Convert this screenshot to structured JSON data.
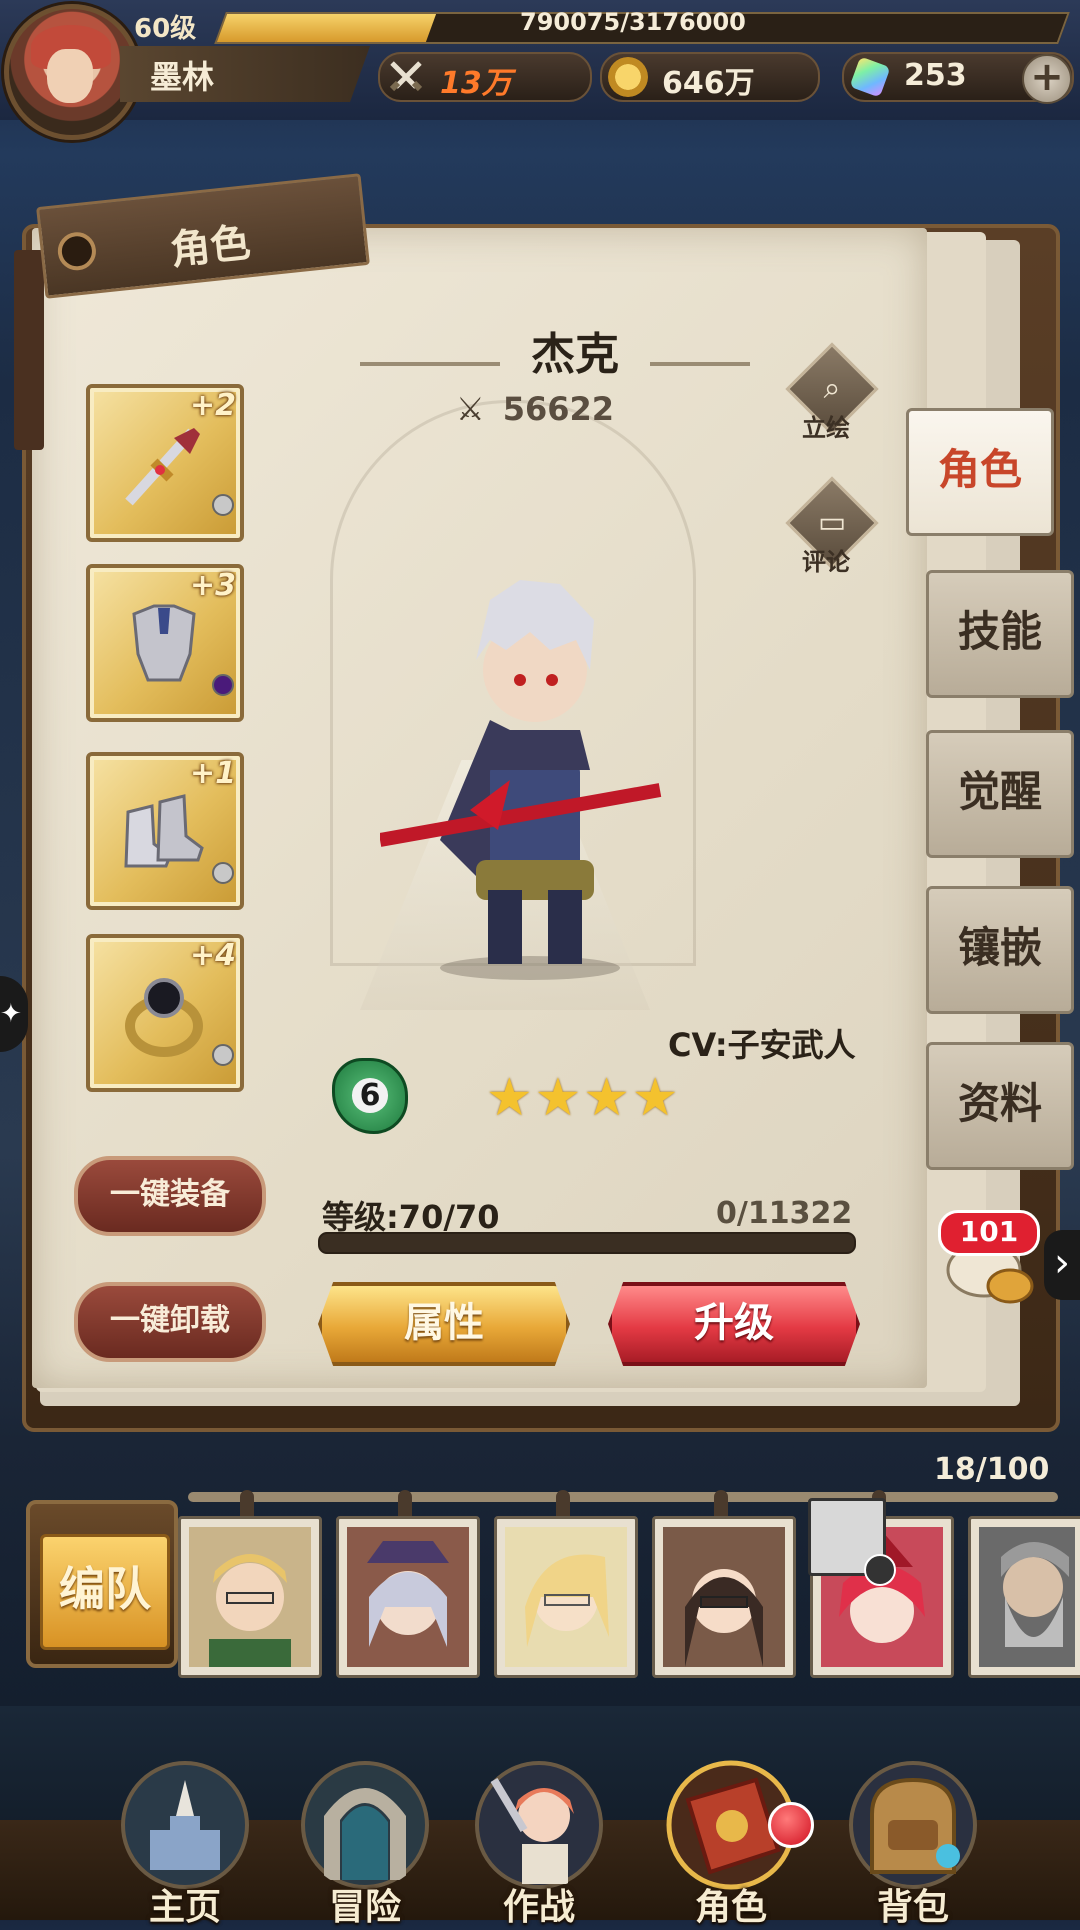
{
  "player": {
    "level": "60级",
    "xp": "790075/3176000",
    "xp_ratio": 0.2488,
    "name": "墨林",
    "avatar": "player-avatar"
  },
  "resources": {
    "power": {
      "icon": "crossed-swords-icon",
      "value": "13万"
    },
    "gold": {
      "icon": "gold-coin-icon",
      "value": "646万"
    },
    "gems": {
      "icon": "crystal-gem-icon",
      "value": "253"
    },
    "add_icon": "plus-icon"
  },
  "panel": {
    "tag": "角色"
  },
  "hero": {
    "name": "杰克",
    "power": "56622",
    "cv": "CV:子安武人",
    "evolution": "6",
    "stars": 4,
    "level_label": "等级:70/70",
    "xp_label": "0/11322",
    "xp_ratio": 0
  },
  "side_actions": {
    "portrait": "立绘",
    "comments": "评论"
  },
  "equipment": [
    {
      "slot": "weapon",
      "icon": "sword-icon",
      "plus": "+2",
      "gem_color": "#c8c8c8"
    },
    {
      "slot": "armor",
      "icon": "chestplate-icon",
      "plus": "+3",
      "gem_color": "#4a1a7a"
    },
    {
      "slot": "boots",
      "icon": "boots-icon",
      "plus": "+1",
      "gem_color": "#c8c8c8"
    },
    {
      "slot": "ring",
      "icon": "ring-icon",
      "plus": "+4",
      "gem_color": "#c8c8c8"
    }
  ],
  "buttons": {
    "equip_all": "一键装备",
    "unequip_all": "一键卸载",
    "attributes": "属性",
    "upgrade": "升级"
  },
  "tabs": [
    {
      "label": "角色",
      "active": true
    },
    {
      "label": "技能",
      "active": false
    },
    {
      "label": "觉醒",
      "active": false
    },
    {
      "label": "镶嵌",
      "active": false
    },
    {
      "label": "资料",
      "active": false
    }
  ],
  "chat": {
    "badge": "101",
    "icon": "chat-bubble-icon"
  },
  "roster": {
    "count": "18/100",
    "team_button": "编队",
    "characters": [
      {
        "name": "character-blond-glasses"
      },
      {
        "name": "character-silver-hair-girl"
      },
      {
        "name": "character-elf-glasses"
      },
      {
        "name": "character-maid-glasses"
      },
      {
        "name": "character-red-hair-girl"
      },
      {
        "name": "character-old-bearded-man"
      }
    ]
  },
  "nav": [
    {
      "label": "主页",
      "icon": "castle-statue-icon"
    },
    {
      "label": "冒险",
      "icon": "portal-arch-icon"
    },
    {
      "label": "作战",
      "icon": "battle-girl-icon"
    },
    {
      "label": "角色",
      "icon": "red-book-icon",
      "badge": true
    },
    {
      "label": "背包",
      "icon": "backpack-icon"
    }
  ],
  "colors": {
    "accent_gold": "#e8a838",
    "accent_red": "#e43a44",
    "active_tab_text": "#c8462a"
  }
}
